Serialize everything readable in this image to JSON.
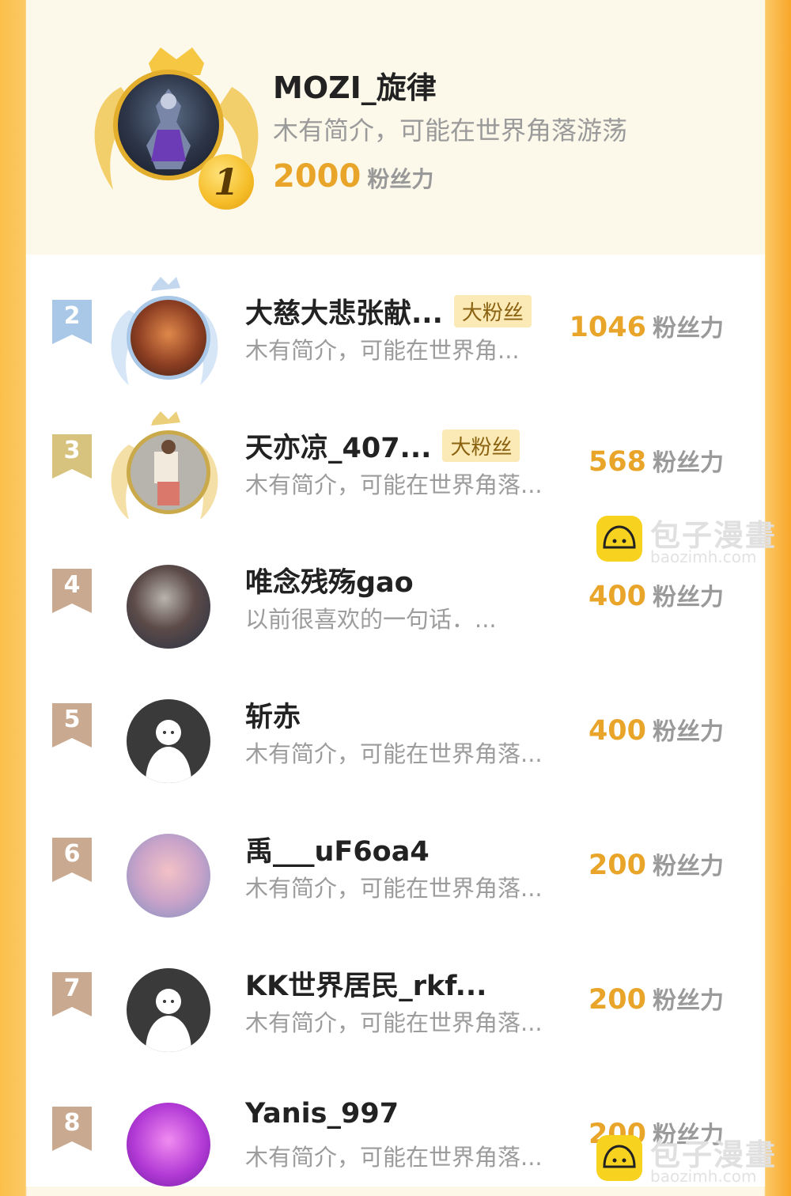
{
  "top_user": {
    "rank": "1",
    "name": "MOZI_旋律",
    "bio": "木有简介，可能在世界角落游荡",
    "score": "2000",
    "unit": "粉丝力"
  },
  "rows": [
    {
      "rank": "2",
      "name": "大慈大悲张献...",
      "badge": "大粉丝",
      "bio": "木有简介，可能在世界角...",
      "score": "1046",
      "unit": "粉丝力"
    },
    {
      "rank": "3",
      "name": "天亦凉_407...",
      "badge": "大粉丝",
      "bio": "木有简介，可能在世界角落...",
      "score": "568",
      "unit": "粉丝力"
    },
    {
      "rank": "4",
      "name": "唯念残殇gao",
      "badge": "",
      "bio": "以前很喜欢的一句话．...",
      "score": "400",
      "unit": "粉丝力"
    },
    {
      "rank": "5",
      "name": "斩赤",
      "badge": "",
      "bio": "木有简介，可能在世界角落...",
      "score": "400",
      "unit": "粉丝力"
    },
    {
      "rank": "6",
      "name": "禹___uF6oa4",
      "badge": "",
      "bio": "木有简介，可能在世界角落...",
      "score": "200",
      "unit": "粉丝力"
    },
    {
      "rank": "7",
      "name": "KK世界居民_rkf...",
      "badge": "",
      "bio": "木有简介，可能在世界角落...",
      "score": "200",
      "unit": "粉丝力"
    },
    {
      "rank": "8",
      "name": "Yanis_997",
      "badge": "",
      "bio": "木有简介，可能在世界角落...",
      "score": "200",
      "unit": "粉丝力"
    }
  ],
  "watermark": {
    "title": "包子漫畫",
    "url": "baozimh.com"
  },
  "colors": {
    "accent": "#e8a52a",
    "gold": "#e3ae2b",
    "silver": "#a9c7e6",
    "bronze": "#c9a98f",
    "background_edge": "#f9a62a"
  }
}
